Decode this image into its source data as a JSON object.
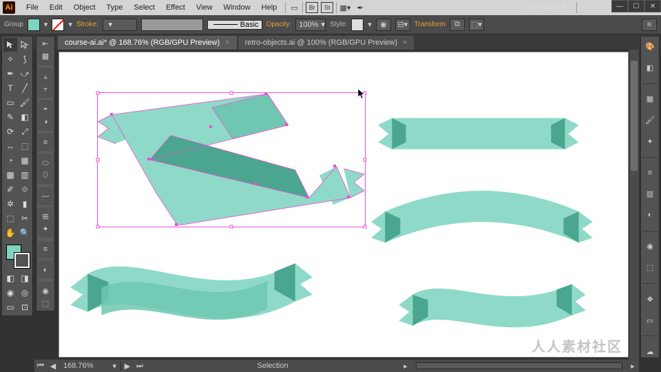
{
  "app": {
    "name": "Ai"
  },
  "menu": [
    "File",
    "Edit",
    "Object",
    "Type",
    "Select",
    "Effect",
    "View",
    "Window",
    "Help"
  ],
  "workspace_label": "Essentials",
  "controlbar": {
    "selection_type": "Group",
    "stroke_label": "Stroke:",
    "stroke_weight": "",
    "stroke_style": "Basic",
    "opacity_label": "Opacity:",
    "opacity_value": "100%",
    "style_label": "Style:",
    "transform_label": "Transform"
  },
  "tabs": [
    {
      "label": "course-ai.ai* @ 168.76% (RGB/GPU Preview)",
      "active": true
    },
    {
      "label": "retro-objects.ai @ 100% (RGB/GPU Preview)",
      "active": false
    }
  ],
  "status": {
    "zoom": "168.76%",
    "mode": "Selection"
  },
  "colors": {
    "ribbon_light": "#8fd9c8",
    "ribbon_mid": "#6fc7b2",
    "ribbon_dark": "#4aa68f",
    "selection": "#ec4ed5"
  },
  "watermark": "人人素材社区"
}
